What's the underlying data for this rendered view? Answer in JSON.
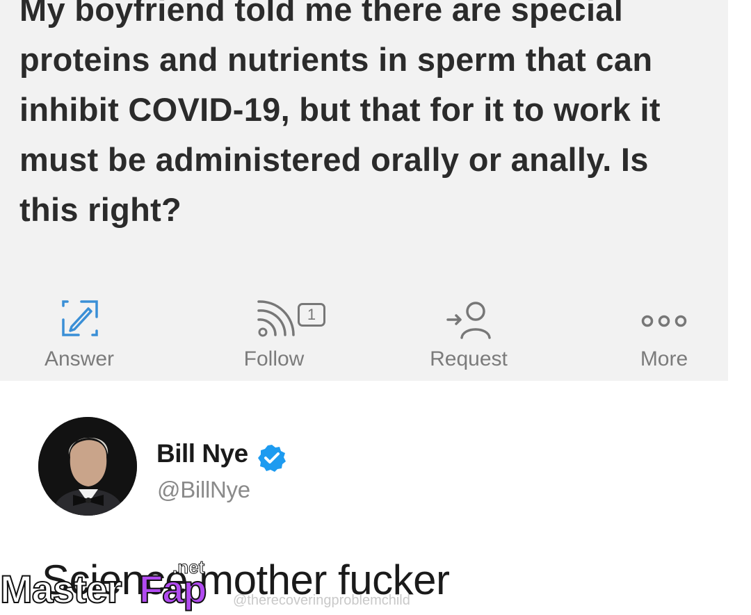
{
  "question": {
    "text": "My boyfriend told me there are special proteins and nutrients in sperm that can inhibit COVID-19, but that for it to work it must be administered orally or anally. Is this right?"
  },
  "actions": [
    {
      "label": "Answer",
      "icon": "edit-square-icon"
    },
    {
      "label": "Follow",
      "icon": "rss-feed-icon",
      "badge": "1"
    },
    {
      "label": "Request",
      "icon": "request-user-icon"
    },
    {
      "label": "More",
      "icon": "more-dots-icon"
    }
  ],
  "tweet": {
    "display_name": "Bill Nye",
    "handle": "@BillNye",
    "verified": true,
    "text": "Science mother fucker",
    "credit": "@therecoveringproblemchild"
  },
  "watermark": {
    "brand_part1": "Master",
    "brand_part2": "Fap",
    "suffix": ".net"
  },
  "colors": {
    "card_background": "#f2f2f2",
    "icon_blue": "#3a8fd6",
    "icon_grey": "#777777",
    "verified_blue": "#1d9bf0",
    "watermark_purple": "#b14bf0"
  }
}
